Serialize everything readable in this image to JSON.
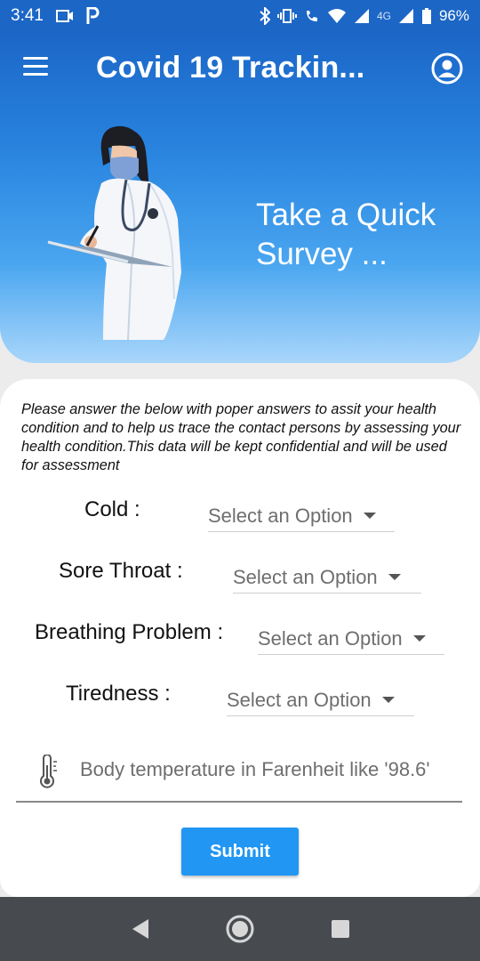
{
  "status_bar": {
    "time": "3:41",
    "battery": "96%",
    "network_label": "4G"
  },
  "app_bar": {
    "title": "Covid 19 Trackin...",
    "menu_icon": "hamburger-menu-icon",
    "account_icon": "account-circle-icon"
  },
  "hero": {
    "line1": "Take a Quick",
    "line2": "Survey ..."
  },
  "survey": {
    "intro": "Please answer the below with poper answers to assit your health condition and to help us trace the contact persons by assessing your health condition.This data will be kept confidential and will be used for assessment",
    "questions": [
      {
        "label": "Cold :",
        "value": "Select an Option"
      },
      {
        "label": "Sore Throat :",
        "value": "Select an Option"
      },
      {
        "label": "Breathing Problem :",
        "value": "Select an Option"
      },
      {
        "label": "Tiredness :",
        "value": "Select an Option"
      }
    ],
    "temperature_placeholder": "Body temperature in Farenheit like '98.6'",
    "submit_label": "Submit"
  },
  "colors": {
    "primary": "#1c66c6",
    "accent": "#2196f3",
    "nav": "#474b50"
  }
}
